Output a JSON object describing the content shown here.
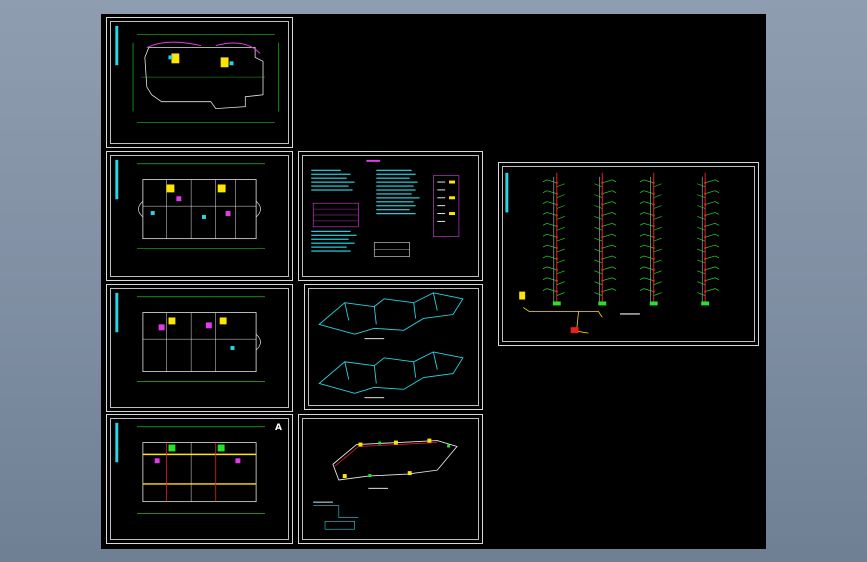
{
  "window": {
    "background_color": "#8a98ab",
    "drawing_background": "#000000"
  },
  "sheets": [
    {
      "id": "sheet-roof-plan"
    },
    {
      "id": "sheet-floor-plan-1"
    },
    {
      "id": "sheet-floor-plan-2"
    },
    {
      "id": "sheet-floor-plan-3",
      "mark": "A"
    },
    {
      "id": "sheet-design-notes"
    },
    {
      "id": "sheet-system-diagrams"
    },
    {
      "id": "sheet-main-pipe-diagram"
    },
    {
      "id": "sheet-riser-diagrams"
    }
  ],
  "colors": {
    "wall": "#e6e6e6",
    "dimension": "#27e327",
    "pipe_cyan": "#25d6e6",
    "pipe_red": "#e52020",
    "yellow": "#ffe600",
    "magenta": "#e23ce8",
    "text": "#f0f0f0"
  }
}
